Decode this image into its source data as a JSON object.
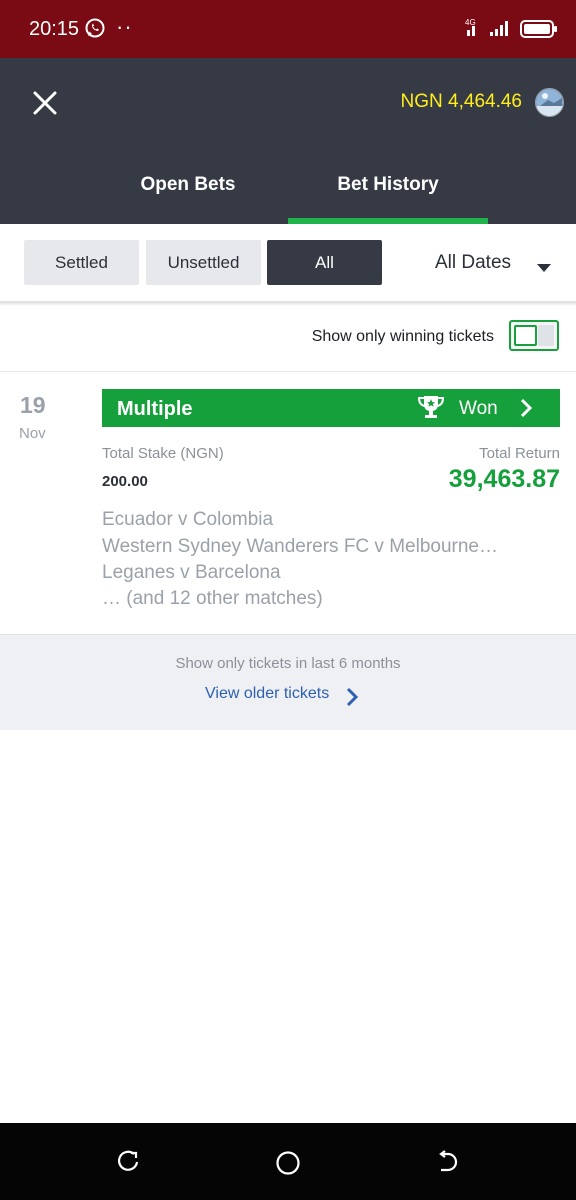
{
  "status_bar": {
    "time": "20:15",
    "dots": "··",
    "icons": [
      "whatsapp-icon",
      "signal-icon",
      "battery-icon"
    ]
  },
  "header": {
    "close_icon": "close-icon",
    "balance": "NGN 4,464.46",
    "tabs": [
      {
        "label": "Open Bets",
        "active": false
      },
      {
        "label": "Bet History",
        "active": true
      }
    ]
  },
  "filters": {
    "buttons": [
      {
        "label": "Settled",
        "active": false
      },
      {
        "label": "Unsettled",
        "active": false
      },
      {
        "label": "All",
        "active": true
      }
    ],
    "date_select": "All Dates"
  },
  "winning_toggle": {
    "label": "Show only winning tickets",
    "enabled": false
  },
  "ticket": {
    "day": "19",
    "month": "Nov",
    "type": "Multiple",
    "status": "Won",
    "stake_label": "Total Stake (NGN)",
    "stake_value": "200.00",
    "return_label": "Total Return",
    "return_value": "39,463.87",
    "matches": [
      "Ecuador v Colombia",
      "Western Sydney Wanderers FC v Melbourne…",
      "Leganes v Barcelona",
      "… (and 12 other matches)"
    ]
  },
  "older": {
    "note": "Show only tickets in last 6 months",
    "link": "View older tickets"
  },
  "colors": {
    "status_bar": "#7a0a13",
    "header": "#353a45",
    "accent_green": "#15a03c",
    "balance_yellow": "#ffee1a",
    "link_blue": "#2e60b2"
  }
}
